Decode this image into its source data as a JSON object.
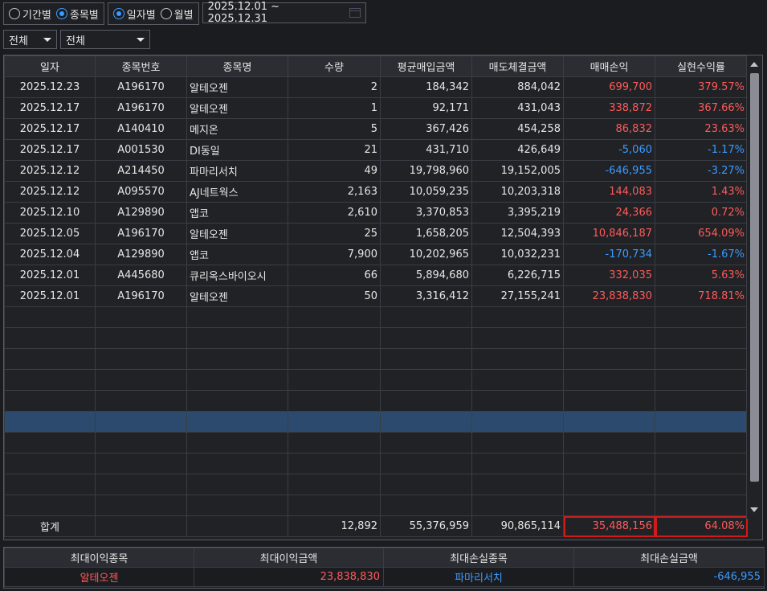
{
  "filters": {
    "range_type": [
      {
        "label": "기간별",
        "checked": false
      },
      {
        "label": "종목별",
        "checked": true
      }
    ],
    "date_type": [
      {
        "label": "일자별",
        "checked": true
      },
      {
        "label": "월별",
        "checked": false
      }
    ],
    "date_range": "2025.12.01 ~ 2025.12.31",
    "select1": "전체",
    "select2": "전체"
  },
  "table": {
    "headers": [
      "일자",
      "종목번호",
      "종목명",
      "수량",
      "평균매입금액",
      "매도체결금액",
      "매매손익",
      "실현수익률"
    ],
    "rows": [
      [
        "2025.12.23",
        "A196170",
        "알테오젠",
        "2",
        "184,342",
        "884,042",
        "699,700",
        "379.57%"
      ],
      [
        "2025.12.17",
        "A196170",
        "알테오젠",
        "1",
        "92,171",
        "431,043",
        "338,872",
        "367.66%"
      ],
      [
        "2025.12.17",
        "A140410",
        "메지온",
        "5",
        "367,426",
        "454,258",
        "86,832",
        "23.63%"
      ],
      [
        "2025.12.17",
        "A001530",
        "DI동일",
        "21",
        "431,710",
        "426,649",
        "-5,060",
        "-1.17%"
      ],
      [
        "2025.12.12",
        "A214450",
        "파마리서치",
        "49",
        "19,798,960",
        "19,152,005",
        "-646,955",
        "-3.27%"
      ],
      [
        "2025.12.12",
        "A095570",
        "AJ네트웍스",
        "2,163",
        "10,059,235",
        "10,203,318",
        "144,083",
        "1.43%"
      ],
      [
        "2025.12.10",
        "A129890",
        "앱코",
        "2,610",
        "3,370,853",
        "3,395,219",
        "24,366",
        "0.72%"
      ],
      [
        "2025.12.05",
        "A196170",
        "알테오젠",
        "25",
        "1,658,205",
        "12,504,393",
        "10,846,187",
        "654.09%"
      ],
      [
        "2025.12.04",
        "A129890",
        "앱코",
        "7,900",
        "10,202,965",
        "10,032,231",
        "-170,734",
        "-1.67%"
      ],
      [
        "2025.12.01",
        "A445680",
        "큐리옥스바이오시",
        "66",
        "5,894,680",
        "6,226,715",
        "332,035",
        "5.63%"
      ],
      [
        "2025.12.01",
        "A196170",
        "알테오젠",
        "50",
        "3,316,412",
        "27,155,241",
        "23,838,830",
        "718.81%"
      ]
    ],
    "total": {
      "label": "합계",
      "quantity": "12,892",
      "avg_buy": "55,376,959",
      "sell_amount": "90,865,114",
      "pnl": "35,488,156",
      "return": "64.08%"
    }
  },
  "summary": {
    "headers": [
      "최대이익종목",
      "최대이익금액",
      "최대손실종목",
      "최대손실금액"
    ],
    "values": [
      "알테오젠",
      "23,838,830",
      "파마리서치",
      "-646,955"
    ]
  },
  "colors": {
    "profit": "#ff5a5a",
    "loss": "#3c9bff",
    "highlight_border": "#d11b1b",
    "selected_row": "#2c4a6e"
  }
}
